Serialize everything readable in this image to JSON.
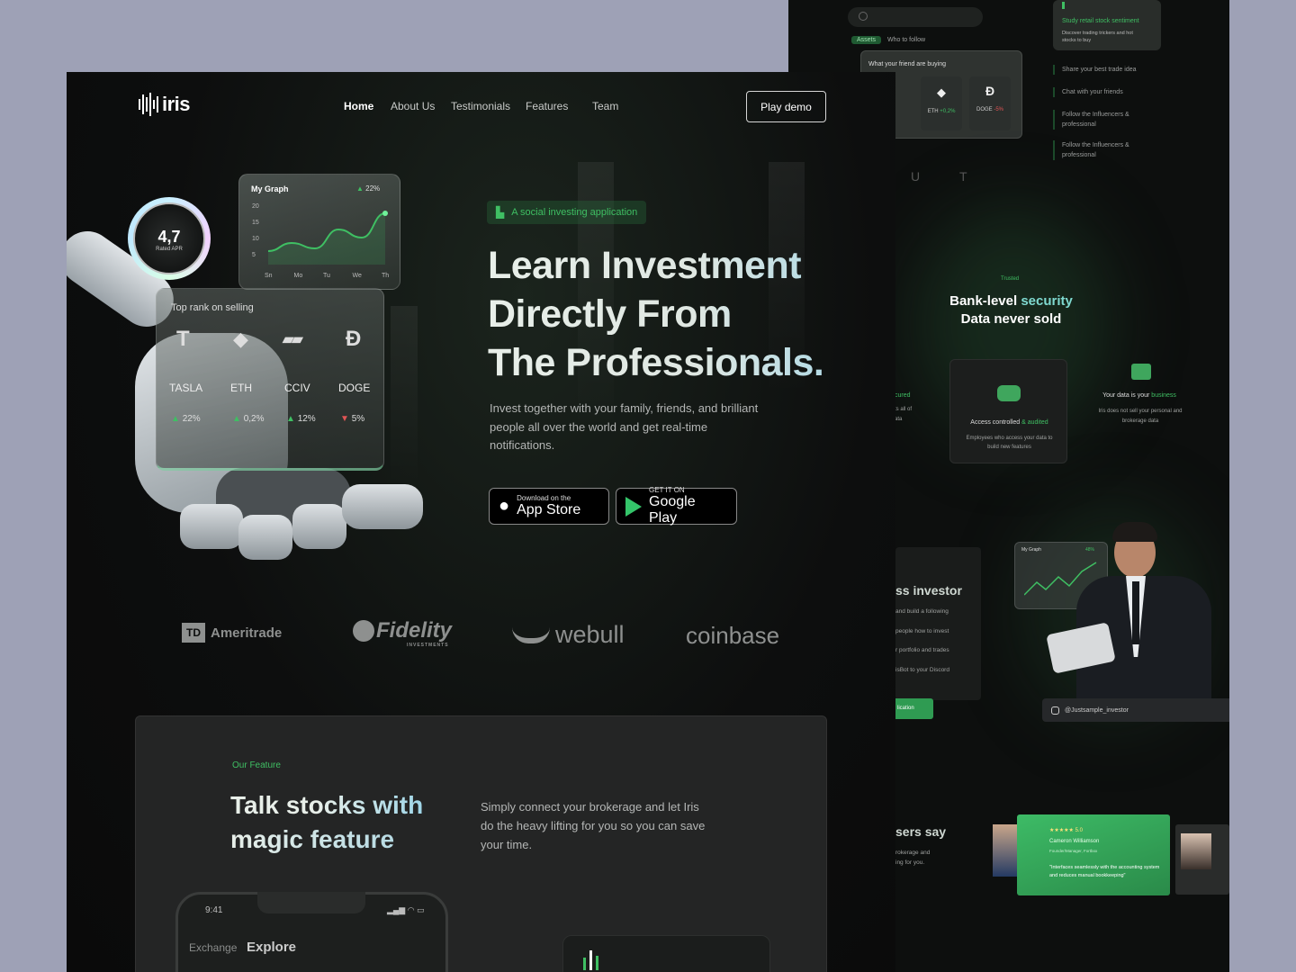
{
  "brand": {
    "name": "iris"
  },
  "nav": {
    "items": [
      "Home",
      "About Us",
      "Testimonials",
      "Features",
      "Team"
    ],
    "cta": "Play demo"
  },
  "hero": {
    "tag": "A social investing application",
    "title_lines": [
      "Learn Investment",
      "Directly From",
      "The Professionals."
    ],
    "subtitle": "Invest together with your family, friends, and brilliant people all over the world and get real-time notifications.",
    "app_store": {
      "small": "Download on the",
      "large": "App Store"
    },
    "google_play": {
      "small": "GET IT ON",
      "large": "Google Play"
    }
  },
  "rating": {
    "value": "4,7",
    "label": "Rated APR"
  },
  "graph_card": {
    "title": "My Graph",
    "change": "22%",
    "y_ticks": [
      "20",
      "15",
      "10",
      "5"
    ],
    "x_ticks": [
      "Sn",
      "Mo",
      "Tu",
      "We",
      "Th"
    ],
    "values": [
      5,
      8,
      6,
      13,
      10,
      19
    ]
  },
  "top_rank": {
    "title": "Top rank on selling",
    "items": [
      {
        "symbol": "TASLA",
        "change": "22%",
        "dir": "up"
      },
      {
        "symbol": "ETH",
        "change": "0,2%",
        "dir": "up"
      },
      {
        "symbol": "CCIV",
        "change": "12%",
        "dir": "up"
      },
      {
        "symbol": "DOGE",
        "change": "5%",
        "dir": "down"
      }
    ]
  },
  "partners": [
    "Ameritrade",
    "Fidelity",
    "webull",
    "coinbase"
  ],
  "partner_extras": {
    "td": "TD",
    "fidelity_sub": "INVESTMENTS"
  },
  "feature": {
    "eyebrow": "Our Feature",
    "title_lines": [
      "Talk stocks with",
      "magic feature"
    ],
    "body": "Simply connect your brokerage and let Iris do the heavy lifting for you so you can save your time.",
    "phone": {
      "time": "9:41",
      "tab1": "Exchange",
      "tab2": "Explore"
    }
  },
  "back": {
    "search_tabs": [
      "Assets",
      "Who to follow"
    ],
    "friends_title": "What your friend are buying",
    "friend_items": [
      {
        "symbol": "ETH",
        "change": "+0,2%"
      },
      {
        "symbol": "DOGE",
        "change": "-5%"
      }
    ],
    "side_panel": {
      "title": "Study retail stock sentiment",
      "text": "Discover trading trickers and hot stocks to buy"
    },
    "side_list": [
      "Share your best trade idea",
      "Chat with your friends",
      "Follow the Influencers & professional",
      "Follow the Influencers & professional"
    ],
    "security_eyebrow": "Trusted",
    "security_title_1": "Bank-level",
    "security_title_accent": "security",
    "security_title_2": "Data never sold",
    "sec_partial_title": "cured",
    "sec_partial_lines": [
      "ts all of",
      "ata"
    ],
    "access_title_a": "Access controlled",
    "access_title_b": "& audited",
    "access_text": "Employees who access your data to build new features",
    "yourdata_title_a": "Your data is your",
    "yourdata_title_b": "business",
    "yourdata_text": "Iris does not sell your personal and brokerage data",
    "investor_title": "ss investor",
    "investor_lines": [
      "and build a following",
      "people how to invest",
      "r portfolio and trades",
      "isBot to your Discord"
    ],
    "investor_button": "lication",
    "mini_graph_title": "My Graph",
    "mini_graph_change": "48%",
    "instagram_handle": "@Justsample_investor",
    "users_say": "sers say",
    "users_lines": [
      "rokerage and",
      "ing for you."
    ],
    "review": {
      "stars": "★★★★★",
      "score": "5.0",
      "name": "Cameron Williamson",
      "role": "Founder/Manager, Fortbox",
      "text": "\"Interfaces seamlessly with the accounting system and reduces manual bookkeeping\""
    }
  },
  "colors": {
    "accent": "#3fbf63",
    "background": "#0d0e0e",
    "page": "#9ea1b6"
  }
}
